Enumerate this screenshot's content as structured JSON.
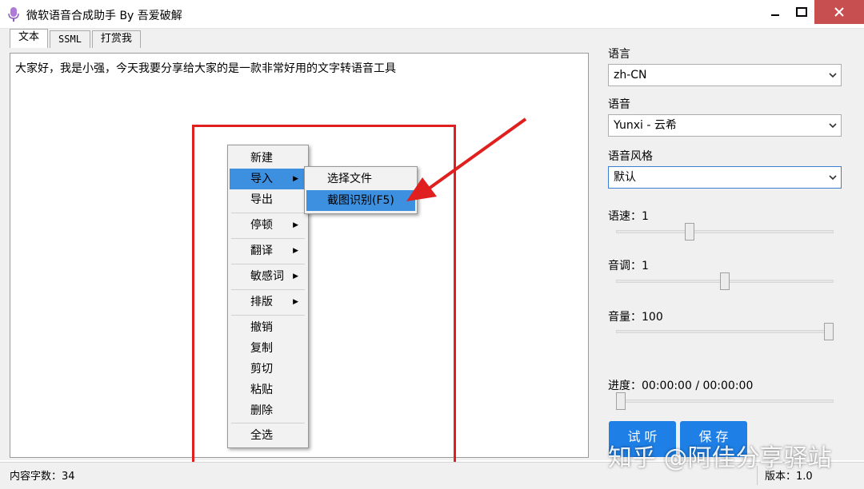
{
  "window": {
    "title": "微软语音合成助手 By 吾爱破解",
    "minimize_icon": "minimize-icon",
    "maximize_icon": "maximize-icon",
    "close_icon": "close-icon",
    "close_color": "#c84f4f"
  },
  "tabs": [
    {
      "label": "文本",
      "active": true
    },
    {
      "label": "SSML",
      "active": false
    },
    {
      "label": "打赏我",
      "active": false
    }
  ],
  "editor": {
    "text": "大家好，我是小强，今天我要分享给大家的是一款非常好用的文字转语音工具"
  },
  "context_menu": {
    "items": [
      {
        "label": "新建"
      },
      {
        "label": "导入",
        "submenu": true,
        "highlighted": true
      },
      {
        "label": "导出"
      },
      {
        "label": "停顿",
        "submenu": true
      },
      {
        "label": "翻译",
        "submenu": true
      },
      {
        "label": "敏感词",
        "submenu": true
      },
      {
        "label": "排版",
        "submenu": true
      },
      {
        "label": "撤销"
      },
      {
        "label": "复制"
      },
      {
        "label": "剪切"
      },
      {
        "label": "粘贴"
      },
      {
        "label": "删除"
      },
      {
        "label": "全选"
      }
    ],
    "submenu": [
      {
        "label": "选择文件"
      },
      {
        "label": "截图识别(F5)",
        "highlighted": true
      }
    ],
    "highlight_color": "#3d8fe0",
    "annotation_color": "#e0201e"
  },
  "settings": {
    "language_label": "语言",
    "language_value": "zh-CN",
    "voice_label": "语音",
    "voice_value": "Yunxi - 云希",
    "style_label": "语音风格",
    "style_value": "默认",
    "speed_label": "语速：1",
    "speed_value": 1,
    "pitch_label": "音调：1",
    "pitch_value": 1,
    "volume_label": "音量：100",
    "volume_value": 100,
    "progress_label": "进度：00:00:00 / 00:00:00",
    "progress_fraction": 0
  },
  "buttons": {
    "listen": "试 听",
    "save": "保 存",
    "color": "#1e7fe6"
  },
  "status": {
    "char_count": "内容字数：34",
    "version": "版本：1.0"
  },
  "watermark": "知乎 @阿佳分享驿站"
}
